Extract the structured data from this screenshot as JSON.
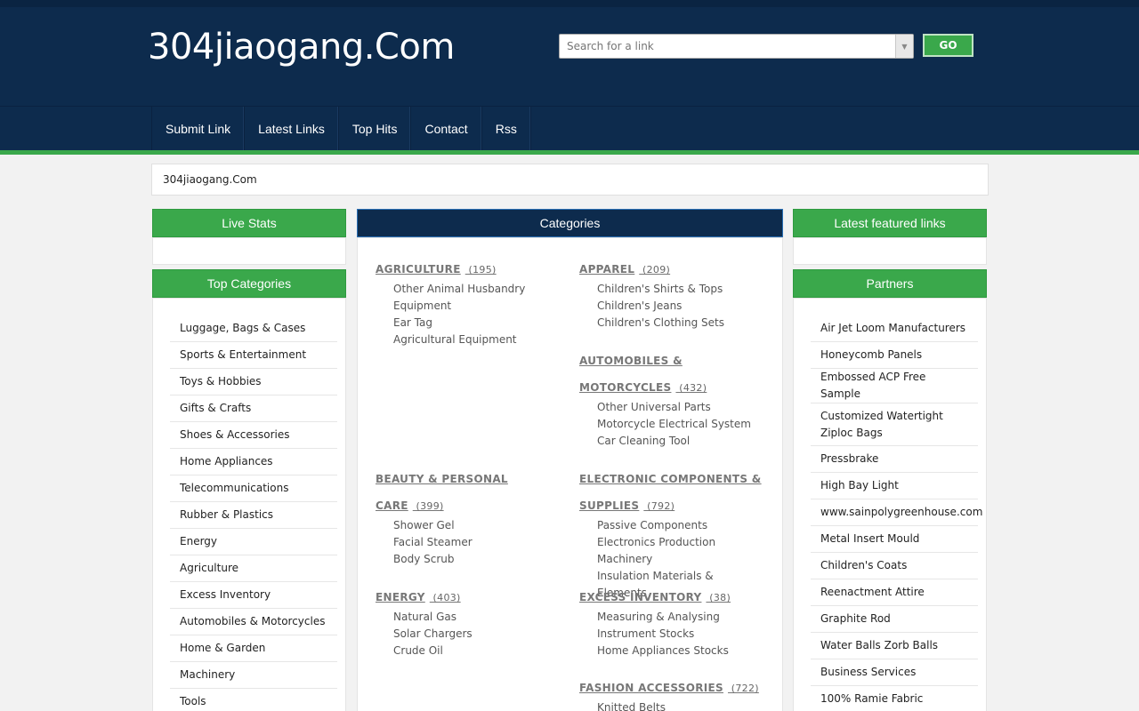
{
  "header": {
    "site_title": "304jiaogang.Com",
    "search_placeholder": "Search for a link",
    "go_label": "GO"
  },
  "nav": [
    "Submit Link",
    "Latest Links",
    "Top Hits",
    "Contact",
    "Rss"
  ],
  "breadcrumb": "304jiaogang.Com",
  "left": {
    "live_stats_title": "Live Stats",
    "top_categories_title": "Top Categories",
    "top_categories": [
      "Luggage, Bags & Cases",
      "Sports & Entertainment",
      "Toys & Hobbies",
      "Gifts & Crafts",
      "Shoes & Accessories",
      "Home Appliances",
      "Telecommunications",
      "Rubber & Plastics",
      "Energy",
      "Agriculture",
      "Excess Inventory",
      "Automobiles & Motorcycles",
      "Home & Garden",
      "Machinery",
      "Tools"
    ]
  },
  "center": {
    "title": "Categories",
    "categories": [
      {
        "line1": "AGRICULTURE",
        "count": "(195)",
        "subs": [
          "Other Animal Husbandry Equipment",
          "Ear Tag",
          "Agricultural Equipment"
        ]
      },
      {
        "line1": "APPAREL",
        "count": "(209)",
        "subs": [
          "Children's Shirts & Tops",
          "Children's Jeans",
          "Children's Clothing Sets"
        ]
      },
      {
        "line1": "AUTOMOBILES &",
        "line2": "MOTORCYCLES",
        "count": "(432)",
        "subs": [
          "Other Universal Parts",
          "Motorcycle Electrical System",
          "Car Cleaning Tool"
        ]
      },
      {
        "line1": "BEAUTY & PERSONAL",
        "line2": "CARE",
        "count": "(399)",
        "subs": [
          "Shower Gel",
          "Facial Steamer",
          "Body Scrub"
        ]
      },
      {
        "line1": "ELECTRONIC COMPONENTS &",
        "line2": "SUPPLIES",
        "count": "(792)",
        "subs": [
          "Passive Components",
          "Electronics Production Machinery",
          "Insulation Materials & Elements"
        ]
      },
      {
        "line1": "ENERGY",
        "count": "(403)",
        "subs": [
          "Natural Gas",
          "Solar Chargers",
          "Crude Oil"
        ]
      },
      {
        "line1": "EXCESS INVENTORY",
        "count": "(38)",
        "subs": [
          "Measuring & Analysing Instrument Stocks",
          "Home Appliances Stocks"
        ]
      },
      {
        "line1": "FASHION ACCESSORIES",
        "count": "(722)",
        "subs": [
          "Knitted Belts"
        ]
      }
    ]
  },
  "right": {
    "featured_title": "Latest featured links",
    "partners_title": "Partners",
    "partners": [
      "Air Jet Loom Manufacturers",
      "Honeycomb Panels",
      "Embossed ACP Free Sample",
      "Customized Watertight Ziploc Bags",
      "Pressbrake",
      "High Bay Light",
      "www.sainpolygreenhouse.com",
      "Metal Insert Mould",
      "Children's Coats",
      "Reenactment Attire",
      "Graphite Rod",
      "Water Balls Zorb Balls",
      "Business Services",
      "100% Ramie Fabric"
    ]
  },
  "colors": {
    "navy": "#0d2b4d",
    "green": "#3aa84b"
  },
  "icons": {
    "search_dropdown": "chevron-down-icon"
  }
}
